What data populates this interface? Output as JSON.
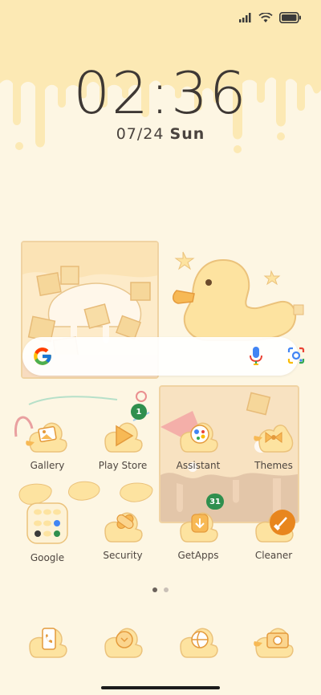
{
  "status_bar": {
    "icons": [
      "signal-icon",
      "wifi-icon",
      "battery-icon"
    ]
  },
  "clock": {
    "time": "02:36",
    "date": "07/24",
    "day": "Sun"
  },
  "search_bar": {
    "icons": [
      "google-logo-icon",
      "mic-icon",
      "lens-icon"
    ]
  },
  "apps": [
    {
      "label": "Gallery"
    },
    {
      "label": "Play Store",
      "badge": "1"
    },
    {
      "label": "Assistant"
    },
    {
      "label": "Themes"
    },
    {
      "label": "Google"
    },
    {
      "label": "Security"
    },
    {
      "label": "GetApps",
      "badge": "31"
    },
    {
      "label": "Cleaner"
    }
  ],
  "dock": [
    {
      "icon": "phone-icon"
    },
    {
      "icon": "messages-icon"
    },
    {
      "icon": "browser-icon"
    },
    {
      "icon": "camera-icon"
    }
  ],
  "page_indicator": {
    "pages": 2,
    "active": 1
  },
  "colors": {
    "background": "#fdf6e3",
    "drip": "#fce9b4",
    "duck": "#fde3a0",
    "badge": "#2f8f4e",
    "cleaner": "#e8861e"
  }
}
